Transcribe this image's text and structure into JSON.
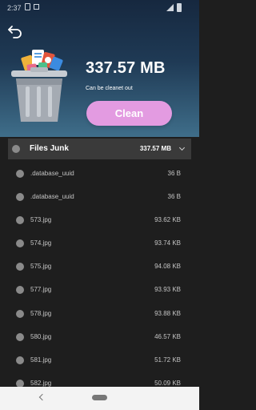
{
  "status_bar": {
    "time": "2:37"
  },
  "summary": {
    "junk_size": "337.57 MB",
    "cleanable_label": "Can be cleanet out",
    "clean_button_label": "Clean"
  },
  "group": {
    "title": "Files Junk",
    "size": "337.57 MB"
  },
  "files": [
    {
      "name": ".database_uuid",
      "size": "36 B"
    },
    {
      "name": ".database_uuid",
      "size": "36 B"
    },
    {
      "name": "573.jpg",
      "size": "93.62 KB"
    },
    {
      "name": "574.jpg",
      "size": "93.74 KB"
    },
    {
      "name": "575.jpg",
      "size": "94.08 KB"
    },
    {
      "name": "577.jpg",
      "size": "93.93 KB"
    },
    {
      "name": "578.jpg",
      "size": "93.88 KB"
    },
    {
      "name": "580.jpg",
      "size": "46.57 KB"
    },
    {
      "name": "581.jpg",
      "size": "51.72 KB"
    },
    {
      "name": "582.jpg",
      "size": "50.09 KB"
    }
  ],
  "colors": {
    "header_top": "#16283f",
    "header_bottom": "#3f6e8a",
    "accent_button": "#e39be1",
    "list_background": "#1e1e1e",
    "group_background": "#3a3a3a"
  }
}
